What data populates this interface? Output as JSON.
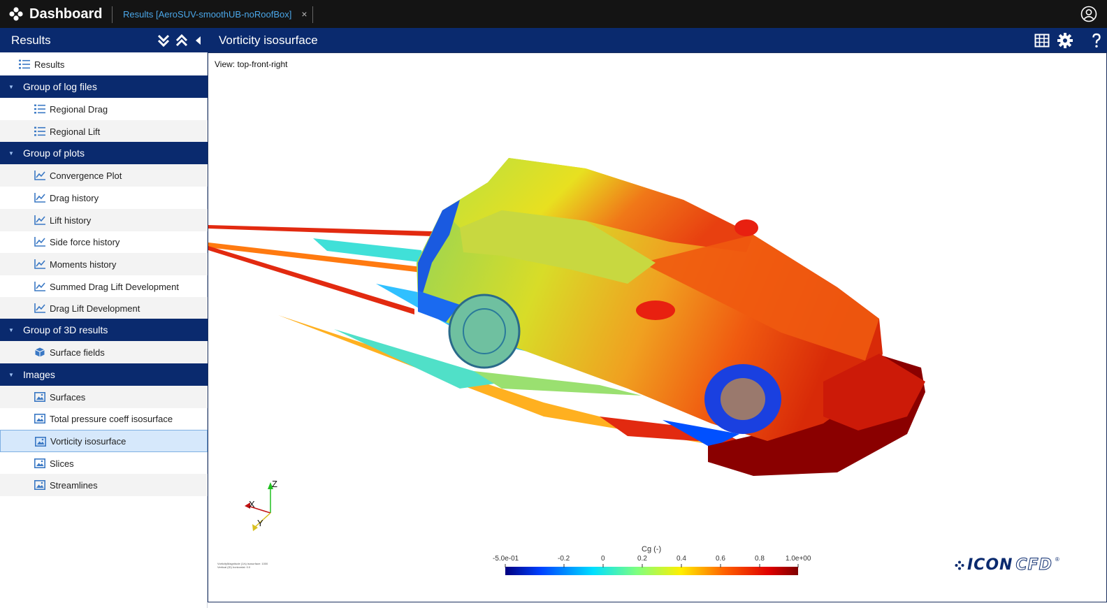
{
  "topbar": {
    "app_title": "Dashboard",
    "tab_label": "Results [AeroSUV-smoothUB-noRoofBox]",
    "tab_close": "×"
  },
  "sidebar": {
    "title": "Results",
    "tree": {
      "root": "Results",
      "groups": [
        {
          "title": "Group of log files",
          "items": [
            "Regional Drag",
            "Regional Lift"
          ]
        },
        {
          "title": "Group of plots",
          "items": [
            "Convergence Plot",
            "Drag history",
            "Lift history",
            "Side force history",
            "Moments history",
            "Summed Drag Lift Development",
            "Drag Lift Development"
          ]
        },
        {
          "title": "Group of 3D results",
          "items": [
            "Surface fields"
          ]
        },
        {
          "title": "Images",
          "items": [
            "Surfaces",
            "Total pressure coeff isosurface",
            "Vorticity isosurface",
            "Slices",
            "Streamlines"
          ]
        }
      ],
      "selected": "Vorticity isosurface"
    }
  },
  "main": {
    "title": "Vorticity isosurface",
    "view_label": "View: top-front-right",
    "colorbar": {
      "title": "Cg (-)",
      "ticks": [
        "-5.0e-01",
        "-0.2",
        "0",
        "0.2",
        "0.4",
        "0.6",
        "0.8",
        "1.0e+00"
      ],
      "range": [
        -0.5,
        1.0
      ]
    },
    "axes": {
      "z": "Z",
      "x": "X",
      "y": "Y"
    },
    "footnote": [
      "VorticityMagnitude (1/s) isosurface: 1000",
      "Vertical (ID) horizontal: 0.0"
    ],
    "logo": {
      "main": "ICON",
      "cfd": "CFD",
      "mark": "®"
    }
  },
  "colors": {
    "header": "#0a2a6e",
    "topbar": "#141414",
    "tab": "#4aa6e8",
    "selected": "#d6e8fb",
    "icon": "#3a78c4"
  }
}
